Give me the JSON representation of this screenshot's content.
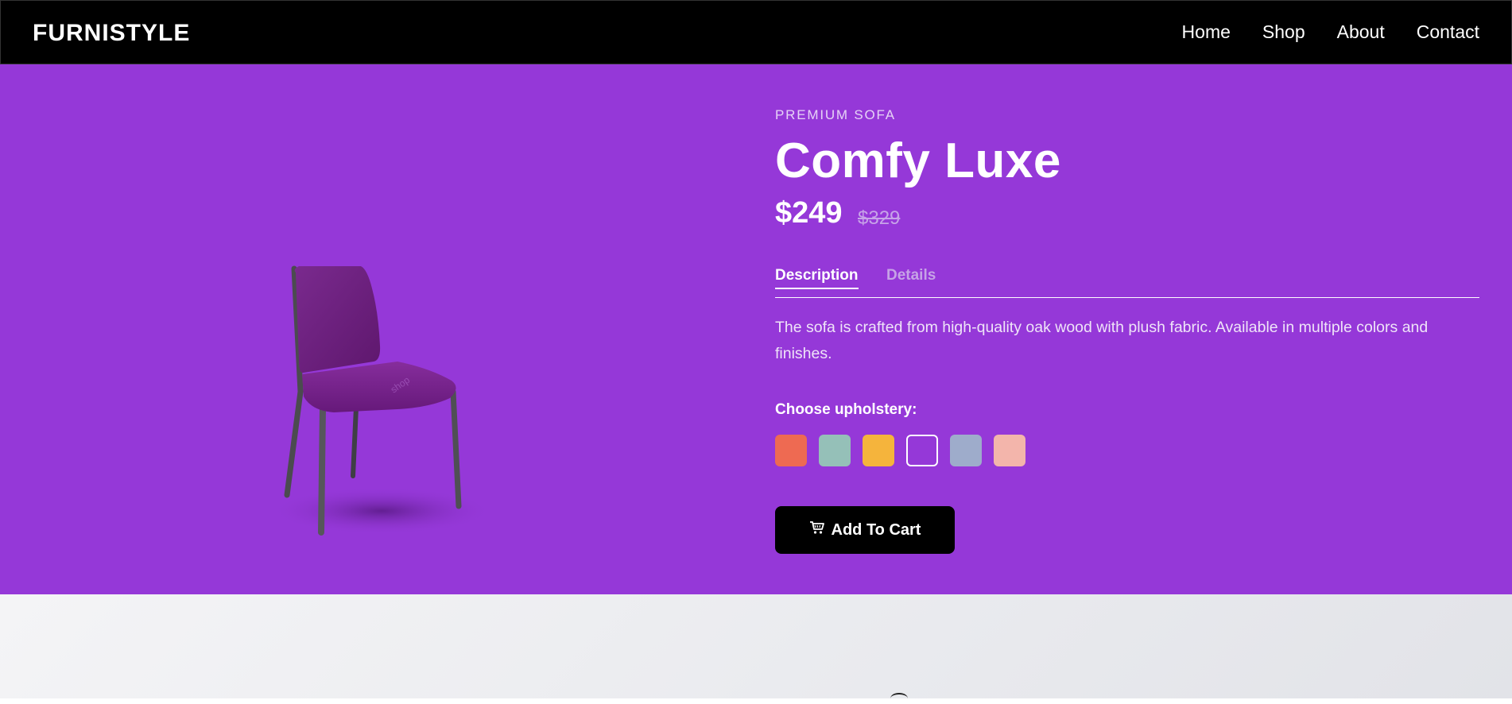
{
  "header": {
    "logo": "FURNISTYLE",
    "nav": [
      "Home",
      "Shop",
      "About",
      "Contact"
    ]
  },
  "hero": {
    "background": "#9538d8",
    "image_alt": "Purple upholstered dining chair with dark metal legs"
  },
  "product": {
    "kicker": "PREMIUM SOFA",
    "title": "Comfy Luxe",
    "price": "$249",
    "old_price": "$329",
    "tabs": [
      {
        "label": "Description",
        "active": true
      },
      {
        "label": "Details",
        "active": false
      }
    ],
    "description": "The sofa is crafted from high-quality oak wood with plush fabric. Available in multiple colors and finishes.",
    "upholstery_label": "Choose upholstery:",
    "swatches": [
      {
        "color": "#ee6a52",
        "selected": false
      },
      {
        "color": "#95c0b8",
        "selected": false
      },
      {
        "color": "#f5b43c",
        "selected": false
      },
      {
        "color": "#9538d8",
        "selected": true
      },
      {
        "color": "#9eaccb",
        "selected": false
      },
      {
        "color": "#f3b5ab",
        "selected": false
      }
    ],
    "cart_icon": "cart-icon",
    "cart_label": "Add To Cart"
  }
}
